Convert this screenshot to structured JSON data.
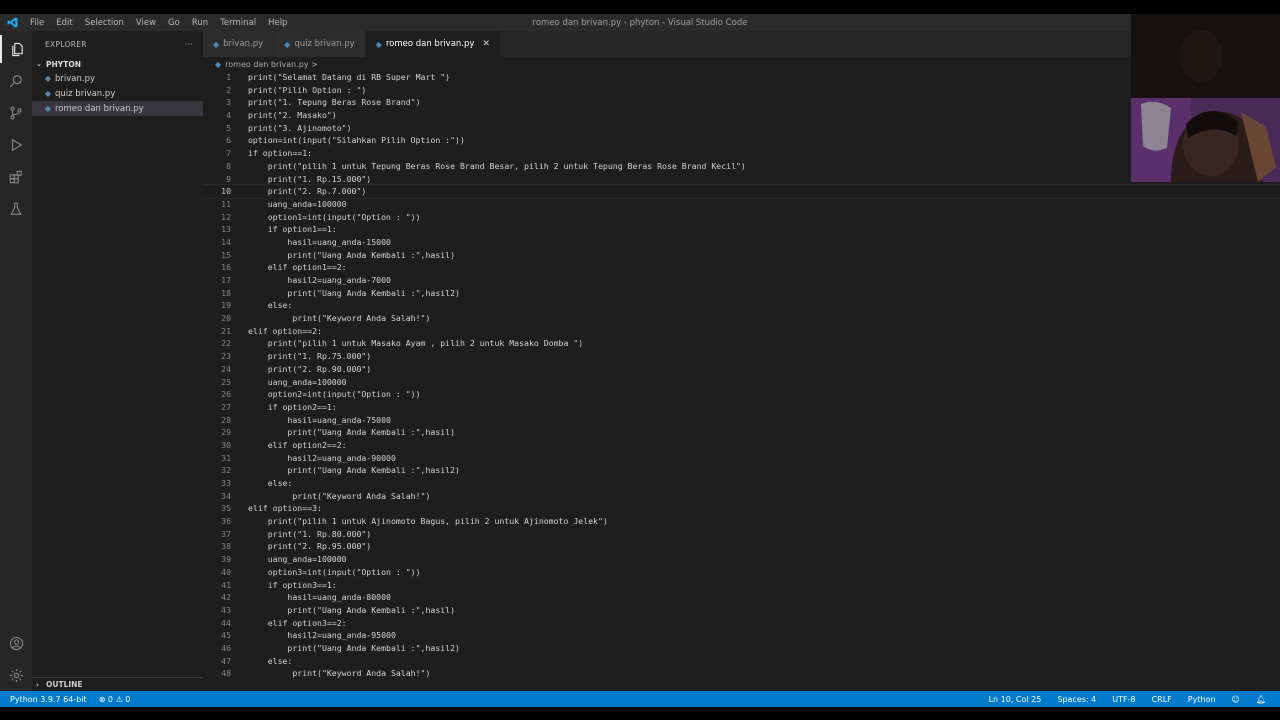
{
  "window": {
    "title": "romeo dan brivan.py - phyton - Visual Studio Code"
  },
  "menu": [
    "File",
    "Edit",
    "Selection",
    "View",
    "Go",
    "Run",
    "Terminal",
    "Help"
  ],
  "sidebar": {
    "title": "EXPLORER",
    "more": "···",
    "folder": "PHYTON",
    "files": [
      {
        "name": "brivan.py"
      },
      {
        "name": "quiz brivan.py"
      },
      {
        "name": "romeo dan brivan.py"
      }
    ],
    "outline": "OUTLINE"
  },
  "tabs": [
    {
      "label": "brivan.py"
    },
    {
      "label": "quiz brivan.py"
    },
    {
      "label": "romeo dan brivan.py"
    }
  ],
  "breadcrumb": "romeo dan brivan.py >",
  "code": [
    "print(\"Selamat Datang di RB Super Mart \")",
    "print(\"Pilih Option : \")",
    "print(\"1. Tepung Beras Rose Brand\")",
    "print(\"2. Masako\")",
    "print(\"3. Ajinomoto\")",
    "option=int(input(\"Silahkan Pilih Option :\"))",
    "if option==1:",
    "    print(\"pilih 1 untuk Tepung Beras Rose Brand Besar, pilih 2 untuk Tepung Beras Rose Brand Kecil\")",
    "    print(\"1. Rp.15.000\")",
    "    print(\"2. Rp.7.000\")",
    "    uang_anda=100000",
    "    option1=int(input(\"Option : \"))",
    "    if option1==1:",
    "        hasil=uang_anda-15000",
    "        print(\"Uang Anda Kembali :\",hasil)",
    "    elif option1==2:",
    "        hasil2=uang_anda-7000",
    "        print(\"Uang Anda Kembali :\",hasil2)",
    "    else:",
    "         print(\"Keyword Anda Salah!\")",
    "elif option==2:",
    "    print(\"pilih 1 untuk Masako Ayam , pilih 2 untuk Masako Domba \")",
    "    print(\"1. Rp.75.000\")",
    "    print(\"2. Rp.90.000\")",
    "    uang_anda=100000",
    "    option2=int(input(\"Option : \"))",
    "    if option2==1:",
    "        hasil=uang_anda-75000",
    "        print(\"Uang Anda Kembali :\",hasil)",
    "    elif option2==2:",
    "        hasil2=uang_anda-90000",
    "        print(\"Uang Anda Kembali :\",hasil2)",
    "    else:",
    "         print(\"Keyword Anda Salah!\")",
    "elif option==3:",
    "    print(\"pilih 1 untuk Ajinomoto Bagus, pilih 2 untuk Ajinomoto Jelek\")",
    "    print(\"1. Rp.80.000\")",
    "    print(\"2. Rp.95.000\")",
    "    uang_anda=100000",
    "    option3=int(input(\"Option : \"))",
    "    if option3==1:",
    "        hasil=uang_anda-80000",
    "        print(\"Uang Anda Kembali :\",hasil)",
    "    elif option3==2:",
    "        hasil2=uang_anda-95000",
    "        print(\"Uang Anda Kembali :\",hasil2)",
    "    else:",
    "         print(\"Keyword Anda Salah!\")"
  ],
  "current_line": 10,
  "status": {
    "python": "Python 3.9.7 64-bit",
    "problems": "⊗ 0 ⚠ 0",
    "position": "Ln 10, Col 25",
    "spaces": "Spaces: 4",
    "encoding": "UTF-8",
    "eol": "CRLF",
    "language": "Python"
  },
  "colors": {
    "statusbar": "#007acc",
    "editor": "#1e1e1e",
    "python_icon": "#4b8bbe"
  }
}
